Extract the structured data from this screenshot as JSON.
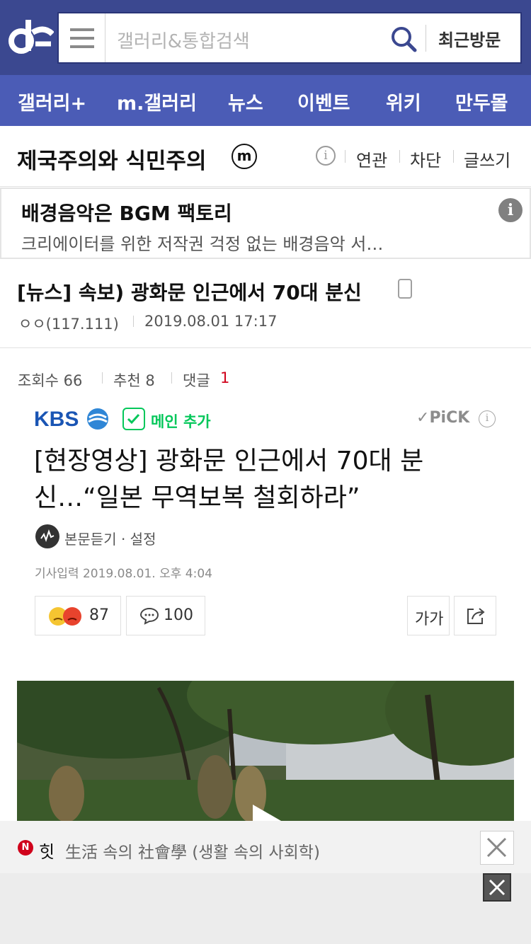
{
  "header": {
    "search_placeholder": "갤러리&통합검색",
    "recent_label": "최근방문",
    "bg_color": "#3b4890"
  },
  "nav": {
    "items": [
      {
        "label": "갤러리+"
      },
      {
        "label": "m.갤러리"
      },
      {
        "label": "뉴스"
      },
      {
        "label": "이벤트"
      },
      {
        "label": "위키"
      },
      {
        "label": "만두몰"
      }
    ],
    "bg_color": "#4b5cb6"
  },
  "gallery": {
    "title": "제국주의와 식민주의",
    "badge": "m",
    "links": [
      "연관",
      "차단",
      "글쓰기"
    ]
  },
  "ad": {
    "title": "배경음악은 BGM 팩토리",
    "desc": "크리에이터를 위한 저작권 걱정 없는 배경음악 서…"
  },
  "post": {
    "title": "[뉴스] 속보) 광화문 인근에서 70대 분신",
    "author": "ㅇㅇ(117.111)",
    "date": "2019.08.01 17:17",
    "views_label": "조회수 66",
    "recommend_label": "추천 8",
    "comments_label": "댓글",
    "comments_count": "1"
  },
  "article": {
    "press": "KBS",
    "main_add_label": "메인 추가",
    "pick_label": "PiCK",
    "title": "[현장영상] 광화문 인근에서 70대 분신…“일본 무역보복 철회하라”",
    "listen_label": "본문듣기 · 설정",
    "date_label": "기사입력  2019.08.01. 오후 4:04",
    "reaction_count": "87",
    "comment_count": "100",
    "font_label": "가가"
  },
  "bottom": {
    "hot_label": "힛",
    "hot_text": "生活 속의 社會學 (생활 속의 사회학)"
  },
  "colors": {
    "accent_red": "#d0021b",
    "naver_green": "#03c75a",
    "kbs_blue": "#1a55b4"
  }
}
